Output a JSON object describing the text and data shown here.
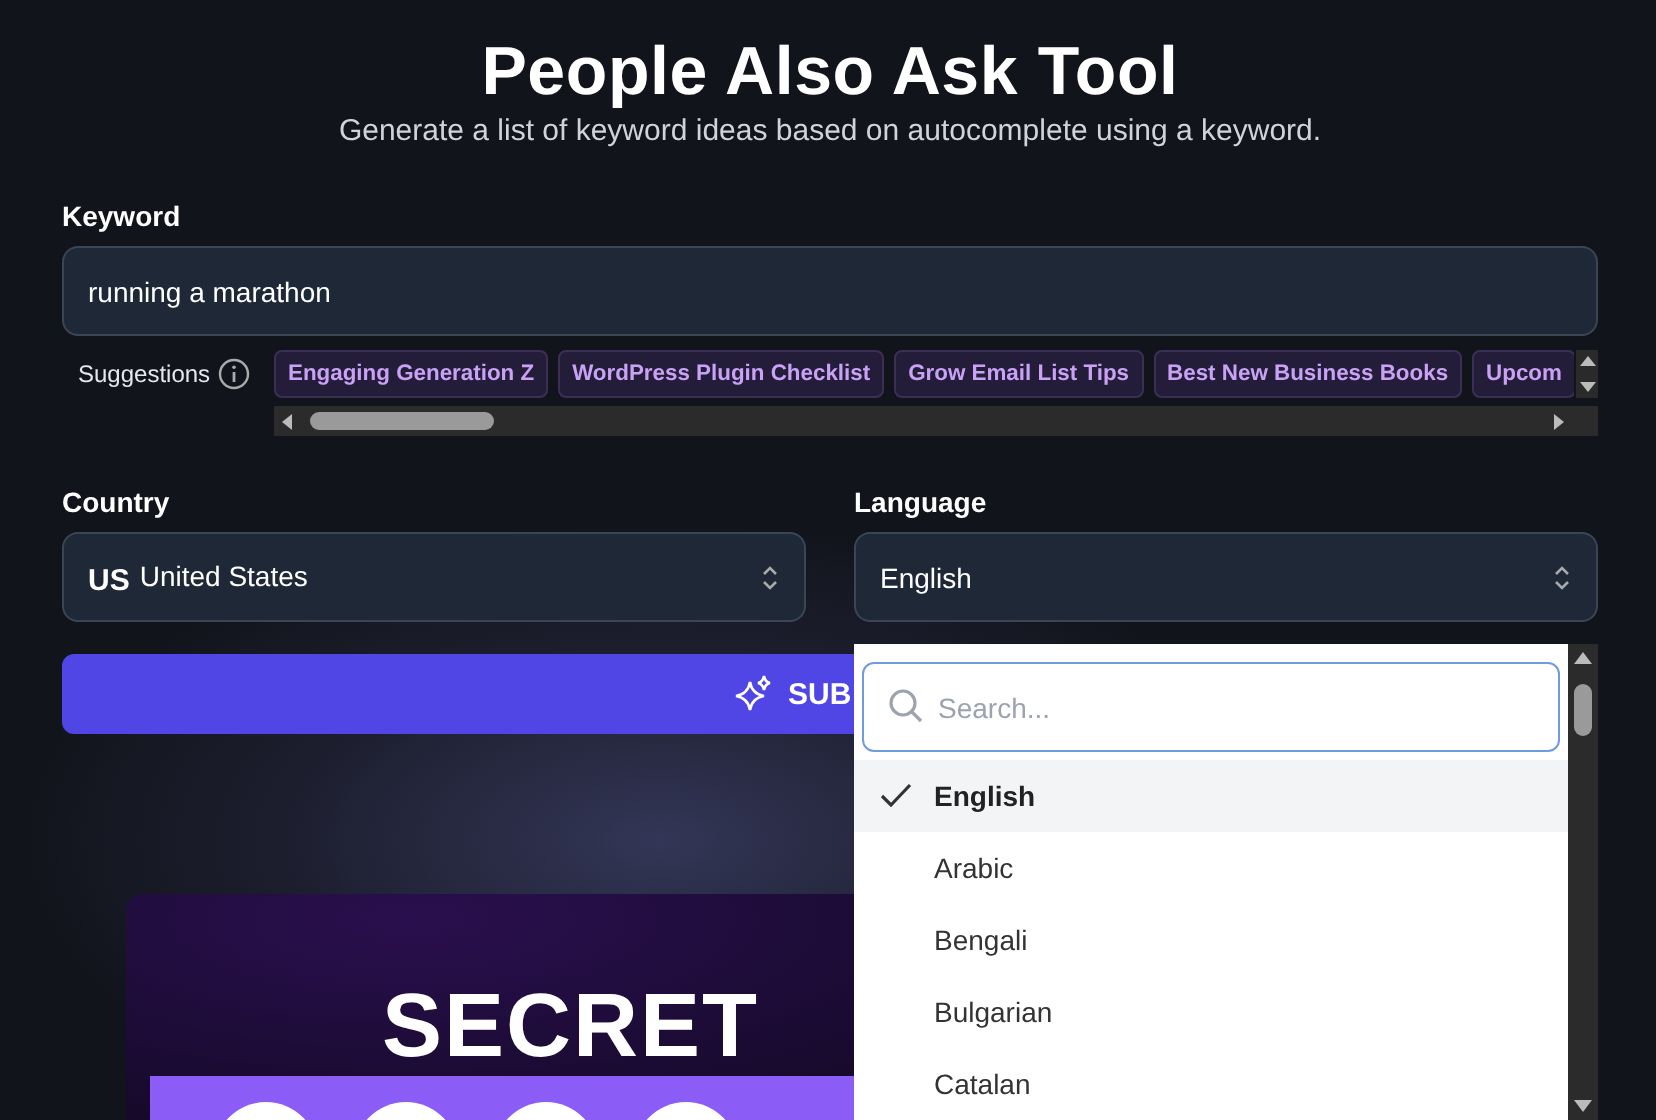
{
  "header": {
    "title": "People Also Ask Tool",
    "subtitle": "Generate a list of keyword ideas based on autocomplete using a keyword."
  },
  "keyword": {
    "label": "Keyword",
    "value": "running a marathon"
  },
  "suggestions": {
    "label": "Suggestions",
    "items": [
      "Engaging Generation Z",
      "WordPress Plugin Checklist",
      "Grow Email List Tips",
      "Best New Business Books",
      "Upcom"
    ]
  },
  "country": {
    "label": "Country",
    "code": "US",
    "value": "United States"
  },
  "language": {
    "label": "Language",
    "value": "English"
  },
  "submit": {
    "label": "SUB"
  },
  "dropdown": {
    "placeholder": "Search...",
    "options": [
      {
        "label": "English",
        "selected": true
      },
      {
        "label": "Arabic",
        "selected": false
      },
      {
        "label": "Bengali",
        "selected": false
      },
      {
        "label": "Bulgarian",
        "selected": false
      },
      {
        "label": "Catalan",
        "selected": false
      }
    ]
  },
  "banner": {
    "text": "SECRET"
  }
}
